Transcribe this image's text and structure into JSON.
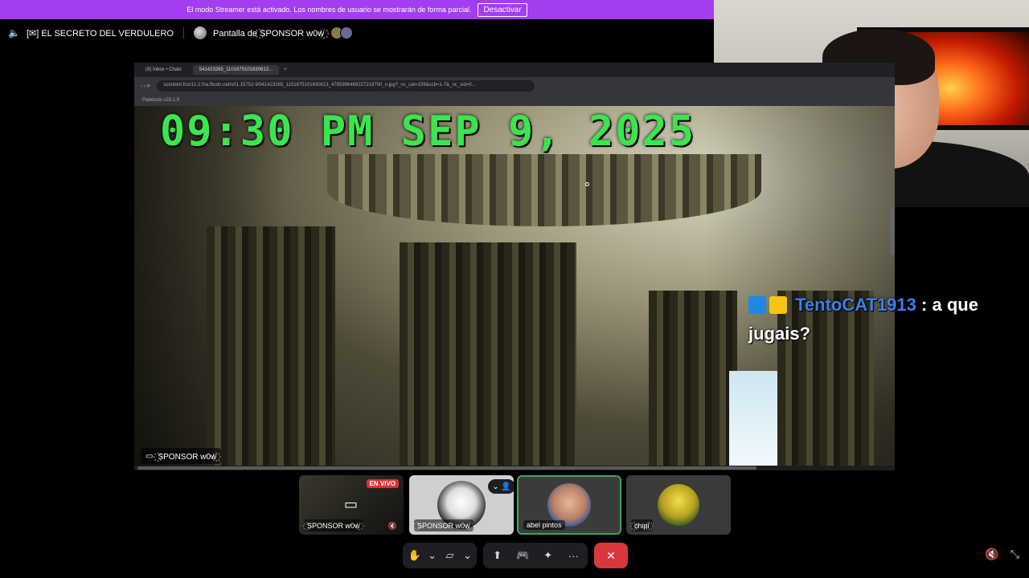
{
  "banner": {
    "message": "El modo Streamer está activado. Los nombres de usuario se mostrarán de forma parcial.",
    "button": "Desactivar"
  },
  "topbar": {
    "channel": "[✉] EL SECRETO DEL VERDULERO",
    "screen_share": "Pantalla de ꙰SPONSOR w0w꙰"
  },
  "browser": {
    "tab1": "(9) Inbox • Chats",
    "tab2": "541423265_1101675101630613...",
    "url": "scontent.fcor11-2.fna.fbcdn.net/v/t1.15752-9/541423265_1101675101630613_4785996469227219750_n.jpg?_nc_cat=109&ccb=1-7&_nc_sid=0...",
    "bookmark": "Paletools v25.1.9"
  },
  "stream": {
    "clock": "09:30 PM  SEP 9, 2025",
    "label": "꙰SPONSOR w0w꙰"
  },
  "chat": {
    "username": "TentoCAT1913",
    "separator": " : ",
    "message": "a que jugais?"
  },
  "tiles": [
    {
      "name": "꙰SPONSOR w0w꙰",
      "live": "EN VIVO"
    },
    {
      "name": "꙰SPONSOR w0w꙰"
    },
    {
      "name": "abel pintos"
    },
    {
      "name": "꙰chipi꙰"
    }
  ],
  "controls": {
    "more": "···",
    "end_call": "✕"
  },
  "colors": {
    "accent": "#a23df0",
    "live": "#e0302f",
    "speaking": "#3ba55c",
    "clock": "#39e64f",
    "chat_user": "#3d7ee8"
  }
}
